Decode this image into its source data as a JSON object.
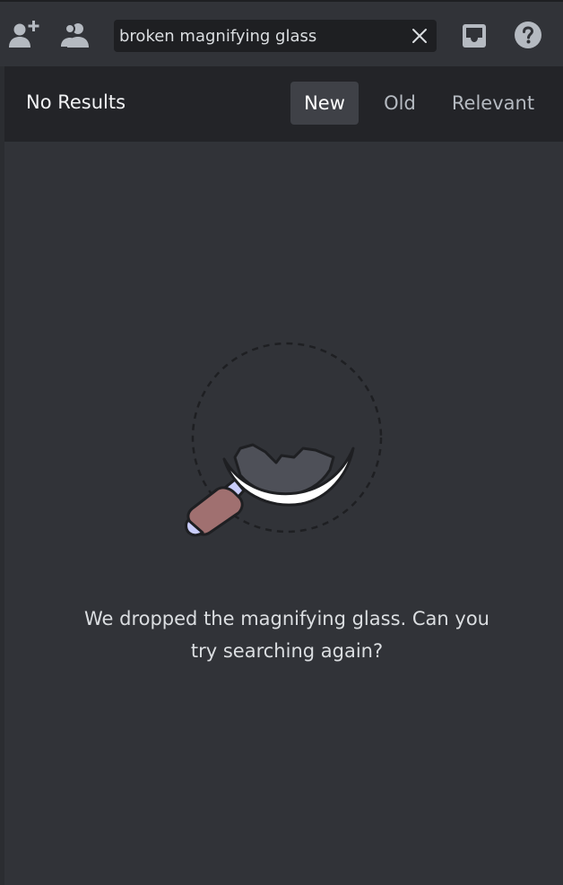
{
  "toolbar": {
    "add_friend_icon": "person-add-icon",
    "members_icon": "members-icon",
    "inbox_icon": "inbox-icon",
    "help_icon": "help-icon"
  },
  "search": {
    "value": "broken magnifying glass",
    "clear_icon": "close-icon"
  },
  "results": {
    "title": "No Results",
    "sort_tabs": [
      {
        "label": "New",
        "active": true
      },
      {
        "label": "Old",
        "active": false
      },
      {
        "label": "Relevant",
        "active": false
      }
    ]
  },
  "empty_state": {
    "illustration": "broken-magnifying-glass",
    "message_line1": "We dropped the magnifying glass. Can you",
    "message_line2": "try searching again?"
  },
  "colors": {
    "background": "#313338",
    "header": "#232428",
    "input": "#1e1f22",
    "active_tab": "#3f4147",
    "handle": "#a07070"
  }
}
